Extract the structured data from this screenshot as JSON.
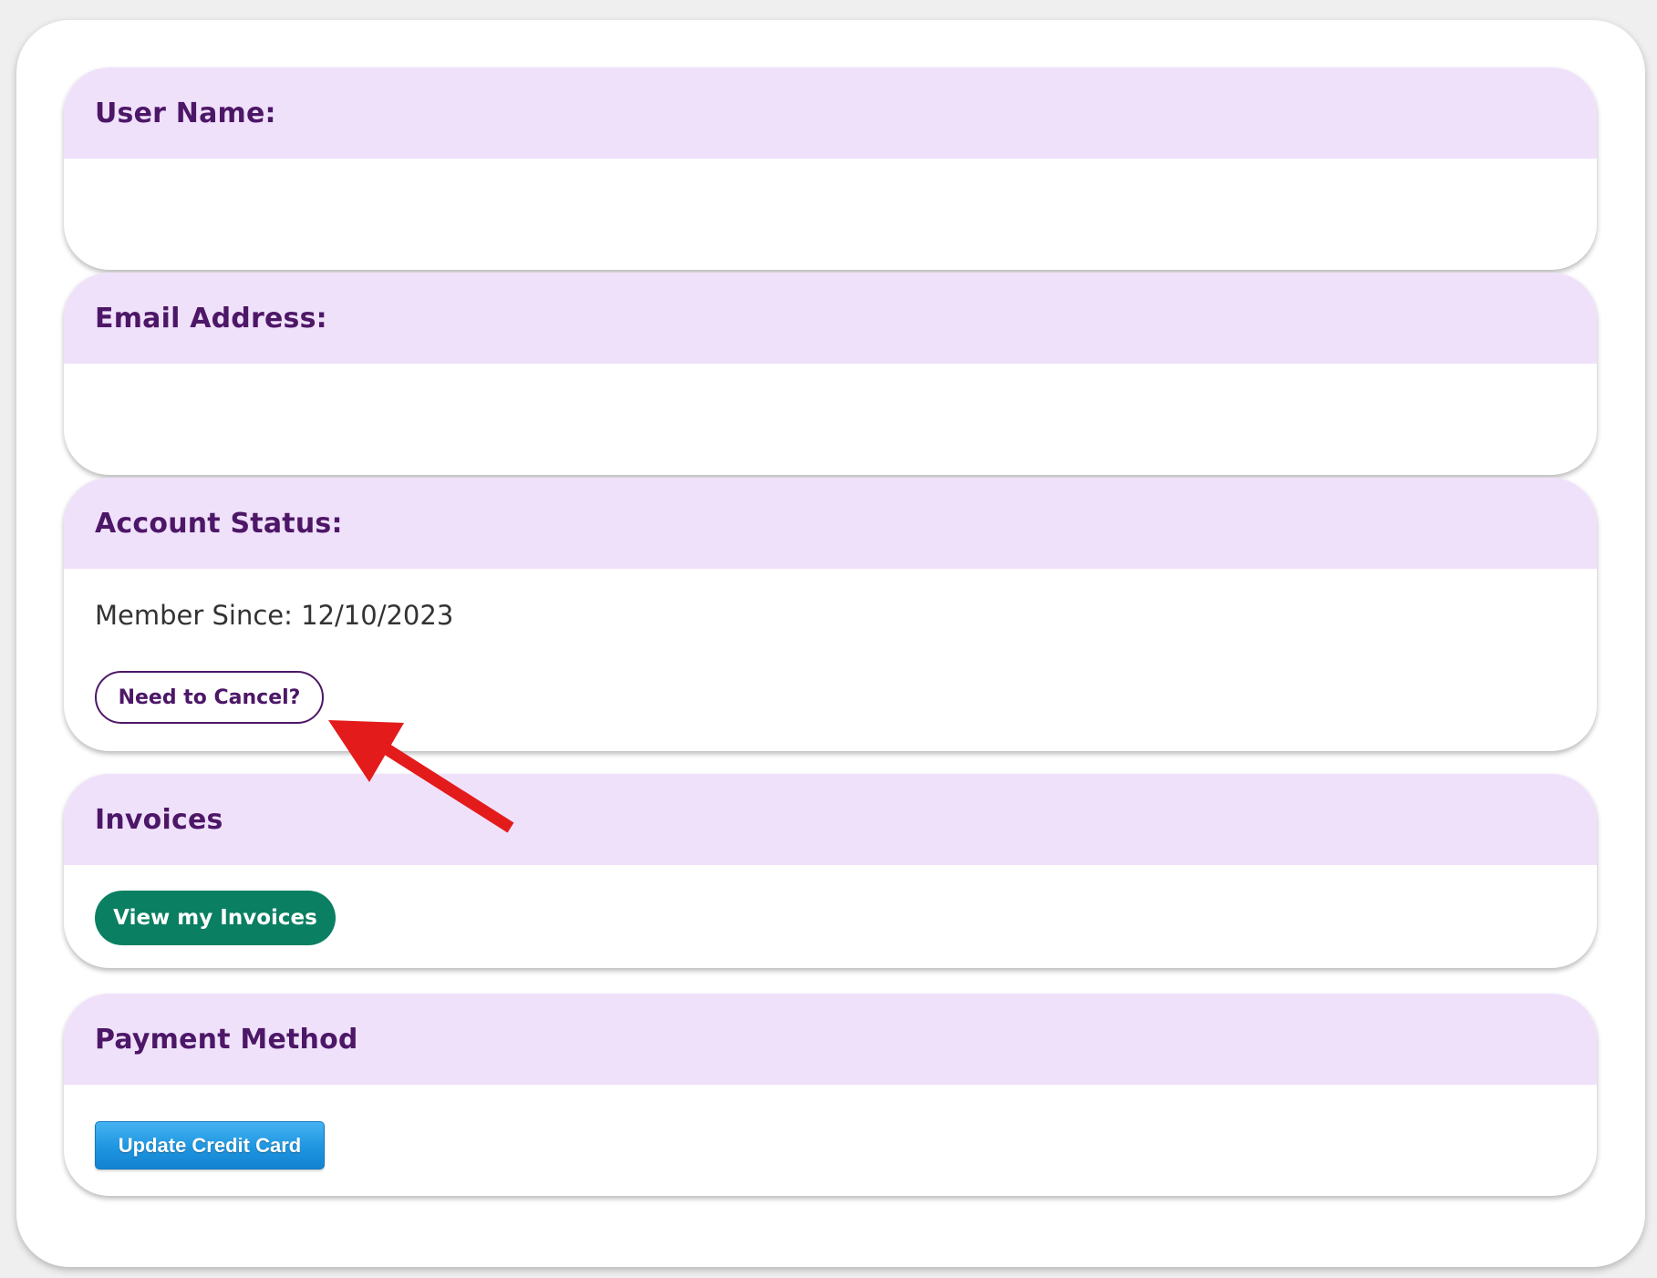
{
  "sections": {
    "user_name": {
      "title": "User Name:",
      "value": ""
    },
    "email": {
      "title": "Email Address:",
      "value": ""
    },
    "account_status": {
      "title": "Account Status:",
      "member_since": "Member Since: 12/10/2023",
      "cancel_label": "Need to Cancel?"
    },
    "invoices": {
      "title": "Invoices",
      "view_label": "View my Invoices"
    },
    "payment": {
      "title": "Payment Method",
      "update_label": "Update Credit Card"
    }
  },
  "colors": {
    "header_bg": "#f0e1fb",
    "title_text": "#4d1767",
    "invoices_button": "#0a7f62",
    "credit_button": "#1e95e0",
    "annotation_arrow": "#e31b1b"
  },
  "icons": {
    "annotation": "red-arrow-icon"
  }
}
